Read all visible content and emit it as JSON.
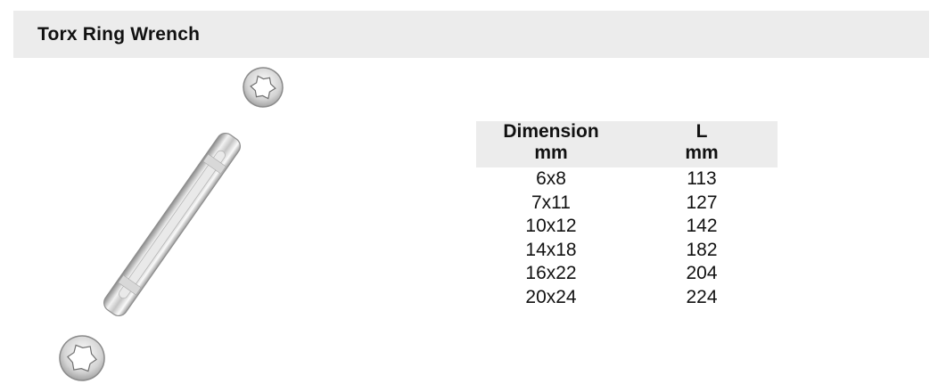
{
  "header": {
    "title": "Torx Ring Wrench"
  },
  "product_image": {
    "icon": "double-ring-wrench-image"
  },
  "spec_table": {
    "columns": [
      {
        "name": "Dimension",
        "unit": "mm"
      },
      {
        "name": "L",
        "unit": "mm"
      }
    ],
    "rows": [
      [
        "6x8",
        "113"
      ],
      [
        "7x11",
        "127"
      ],
      [
        "10x12",
        "142"
      ],
      [
        "14x18",
        "182"
      ],
      [
        "16x22",
        "204"
      ],
      [
        "20x24",
        "224"
      ]
    ]
  },
  "colors": {
    "header_background": "#ececec",
    "text": "#111111"
  }
}
